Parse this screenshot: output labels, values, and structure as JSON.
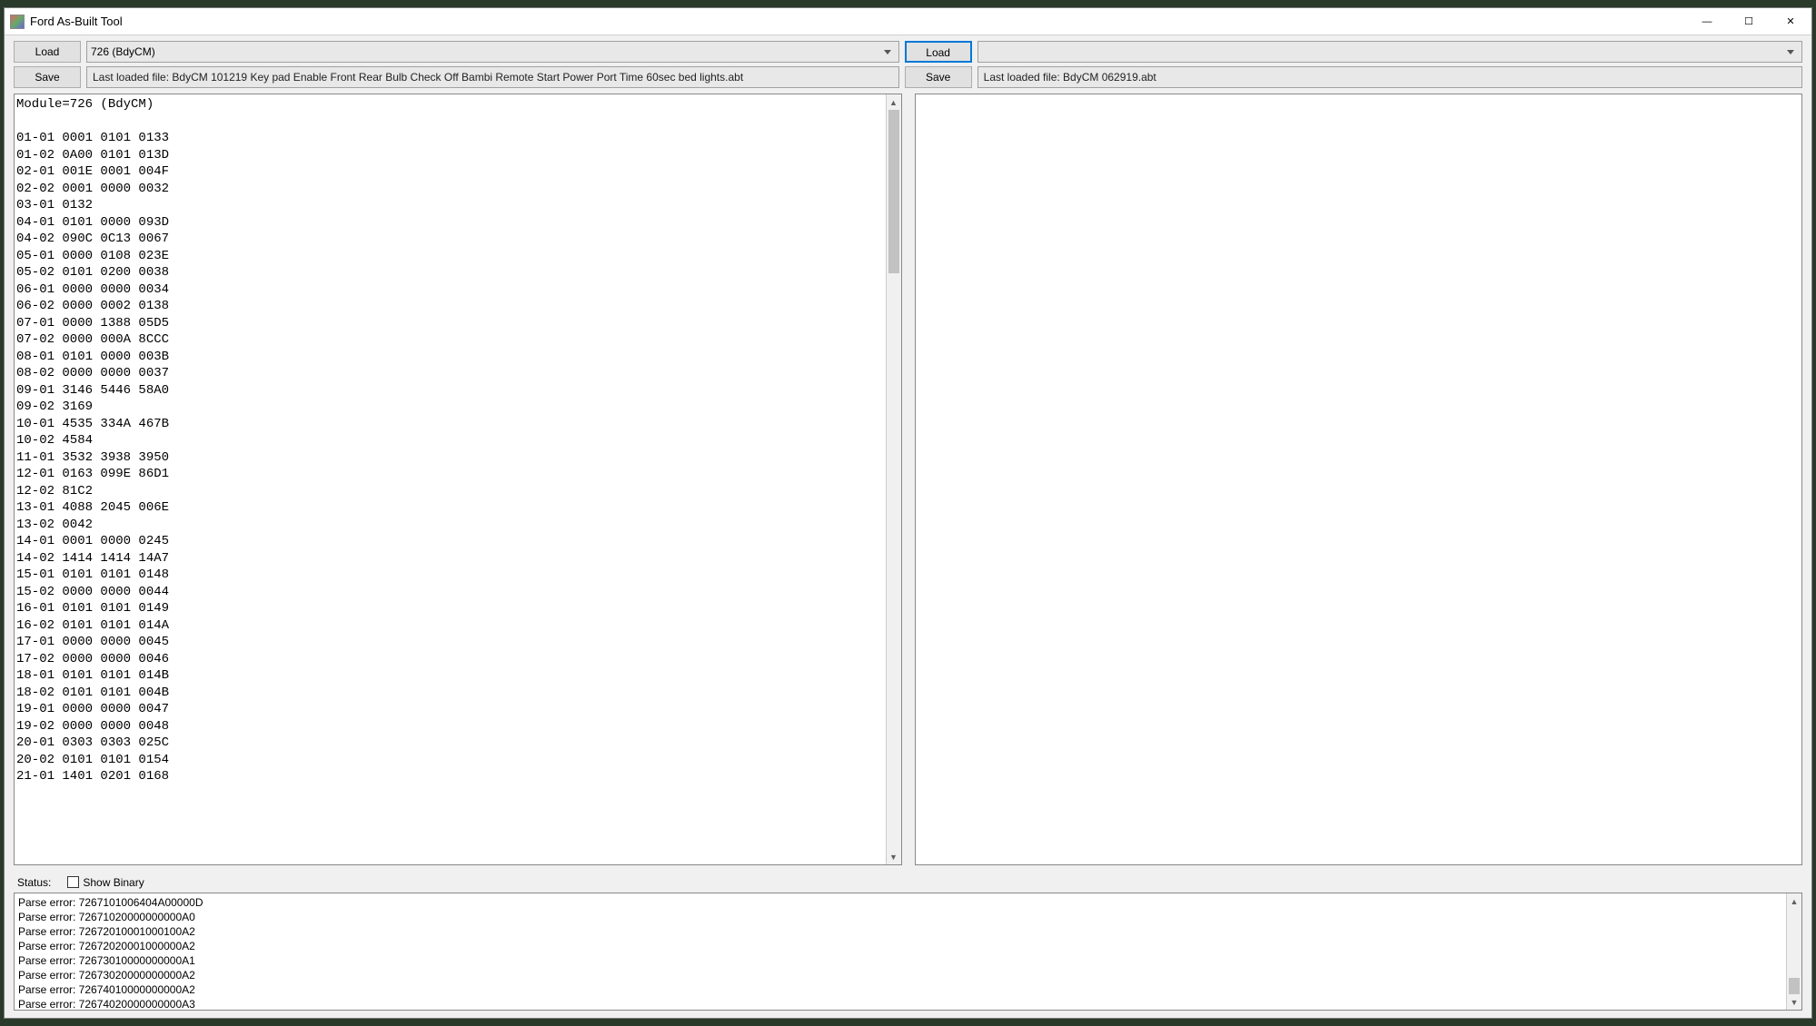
{
  "window": {
    "title": "Ford As-Built Tool"
  },
  "win_controls": {
    "minimize": "—",
    "maximize": "☐",
    "close": "✕"
  },
  "left": {
    "load_label": "Load",
    "save_label": "Save",
    "combo_value": "726 (BdyCM)",
    "last_file": "Last loaded file: BdyCM 101219 Key pad Enable Front Rear Bulb Check Off Bambi Remote Start Power Port Time 60sec bed lights.abt",
    "text_lines": [
      "Module=726 (BdyCM)",
      "",
      "01-01 0001 0101 0133",
      "01-02 0A00 0101 013D",
      "02-01 001E 0001 004F",
      "02-02 0001 0000 0032",
      "03-01 0132",
      "04-01 0101 0000 093D",
      "04-02 090C 0C13 0067",
      "05-01 0000 0108 023E",
      "05-02 0101 0200 0038",
      "06-01 0000 0000 0034",
      "06-02 0000 0002 0138",
      "07-01 0000 1388 05D5",
      "07-02 0000 000A 8CCC",
      "08-01 0101 0000 003B",
      "08-02 0000 0000 0037",
      "09-01 3146 5446 58A0",
      "09-02 3169",
      "10-01 4535 334A 467B",
      "10-02 4584",
      "11-01 3532 3938 3950",
      "12-01 0163 099E 86D1",
      "12-02 81C2",
      "13-01 4088 2045 006E",
      "13-02 0042",
      "14-01 0001 0000 0245",
      "14-02 1414 1414 14A7",
      "15-01 0101 0101 0148",
      "15-02 0000 0000 0044",
      "16-01 0101 0101 0149",
      "16-02 0101 0101 014A",
      "17-01 0000 0000 0045",
      "17-02 0000 0000 0046",
      "18-01 0101 0101 014B",
      "18-02 0101 0101 004B",
      "19-01 0000 0000 0047",
      "19-02 0000 0000 0048",
      "20-01 0303 0303 025C",
      "20-02 0101 0101 0154",
      "21-01 1401 0201 0168"
    ]
  },
  "right": {
    "load_label": "Load",
    "save_label": "Save",
    "combo_value": "",
    "last_file": "Last loaded file: BdyCM 062919.abt",
    "text_lines": []
  },
  "status": {
    "label": "Status:",
    "show_binary_label": "Show Binary",
    "show_binary_checked": false,
    "lines": [
      "Parse error: 7267101006404A00000D",
      "Parse error: 72671020000000000A0",
      "Parse error: 72672010001000100A2",
      "Parse error: 72672020001000000A2",
      "Parse error: 72673010000000000A1",
      "Parse error: 72673020000000000A2",
      "Parse error: 72674010000000000A2",
      "Parse error: 72674020000000000A3"
    ]
  }
}
